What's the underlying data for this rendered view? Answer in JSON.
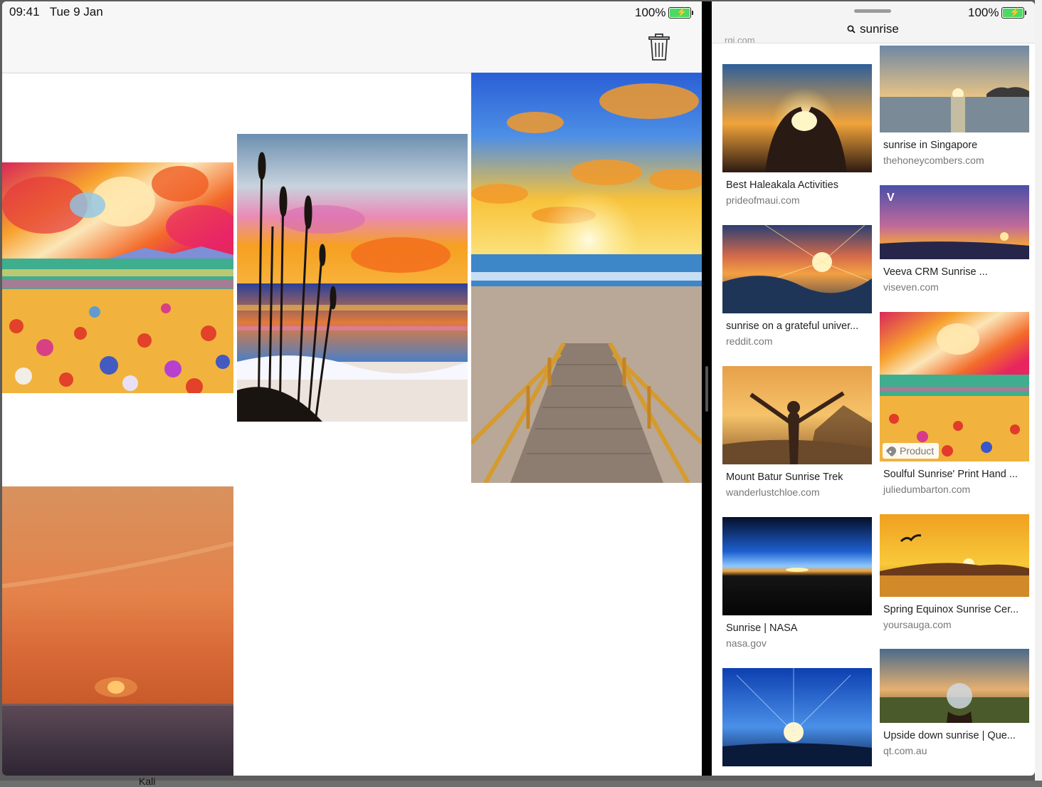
{
  "status_bar": {
    "time": "09:41",
    "date": "Tue 9 Jan",
    "battery_left": "100%",
    "battery_right": "100%"
  },
  "left_pane": {
    "toolbar": {
      "delete_icon": "trash-icon"
    },
    "images": [
      {
        "description": "colorful painted sunset over flower meadow"
      },
      {
        "description": "painted beach sunset with sea oats"
      },
      {
        "description": "wooden boardwalk to beach at sunrise"
      },
      {
        "description": "orange sunset over the sea"
      }
    ]
  },
  "right_pane": {
    "search": {
      "icon": "search-icon",
      "query": "sunrise"
    },
    "cutoff_source": "rgj.com",
    "results_left": [
      {
        "title": "Best Haleakala Activities",
        "source": "prideofmaui.com"
      },
      {
        "title": "sunrise on a grateful univer...",
        "source": "reddit.com"
      },
      {
        "title": "Mount Batur Sunrise Trek",
        "source": "wanderlustchloe.com"
      },
      {
        "title": "Sunrise | NASA",
        "source": "nasa.gov"
      },
      {
        "title": "",
        "source": ""
      }
    ],
    "results_right": [
      {
        "title": "sunrise in Singapore",
        "source": "thehoneycombers.com"
      },
      {
        "title": "Veeva CRM Sunrise ...",
        "source": "viseven.com"
      },
      {
        "title": "Soulful Sunrise' Print Hand ...",
        "source": "juliedumbarton.com",
        "badge": "Product"
      },
      {
        "title": "Spring Equinox Sunrise Cer...",
        "source": "yoursauga.com"
      },
      {
        "title": "Upside down sunrise | Que...",
        "source": "qt.com.au"
      }
    ]
  },
  "background_app_peek": {
    "bottom_text": "Kali"
  },
  "colors": {
    "battery_green": "#4cd964",
    "divider": "#000000"
  }
}
